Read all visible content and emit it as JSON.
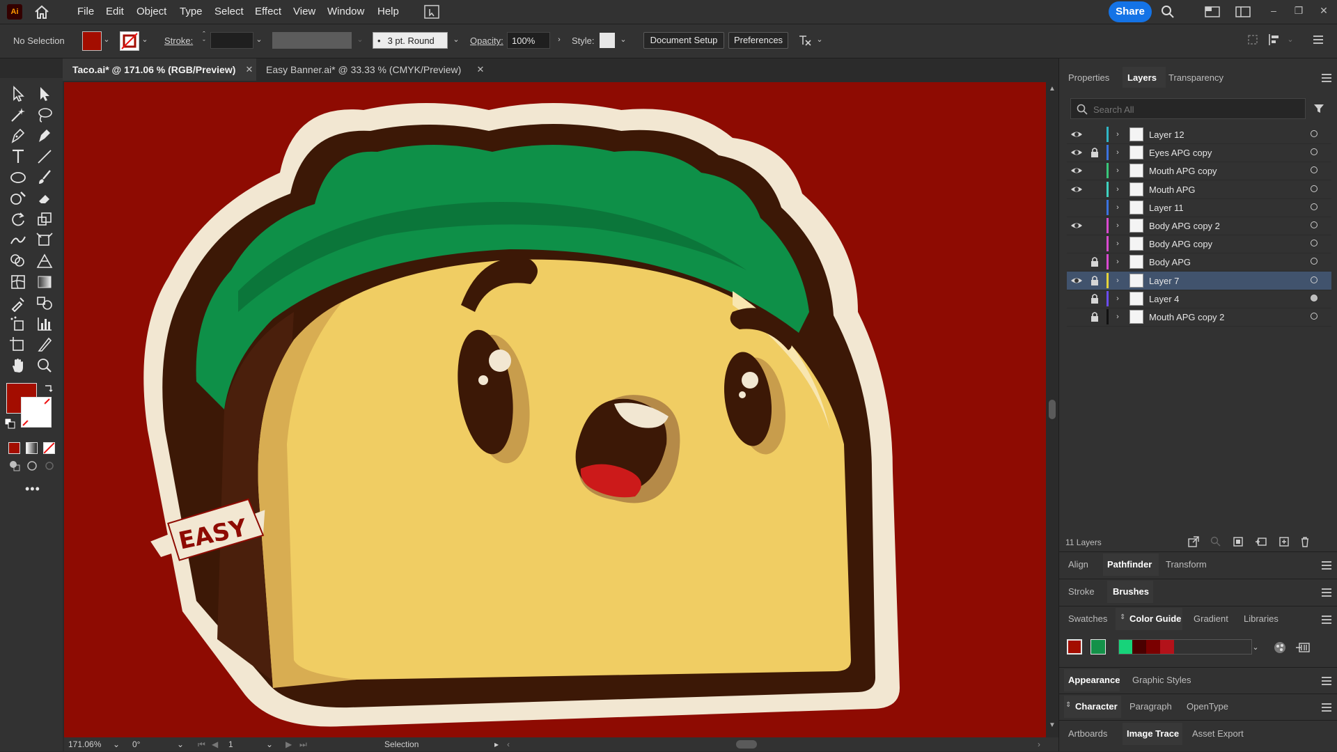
{
  "app": {
    "logo_text": "Ai"
  },
  "menu": [
    "File",
    "Edit",
    "Object",
    "Type",
    "Select",
    "Effect",
    "View",
    "Window",
    "Help"
  ],
  "share_label": "Share",
  "control_bar": {
    "selection_status": "No Selection",
    "stroke_label": "Stroke:",
    "brush_value": "3 pt. Round",
    "opacity_label": "Opacity:",
    "opacity_value": "100%",
    "style_label": "Style:",
    "document_setup": "Document Setup",
    "preferences": "Preferences",
    "fill_color": "#a30d00"
  },
  "tabs": [
    {
      "label": "Taco.ai* @ 171.06 % (RGB/Preview)",
      "active": true
    },
    {
      "label": "Easy Banner.ai* @ 33.33 % (CMYK/Preview)",
      "active": false
    }
  ],
  "canvas": {
    "background": "#8e0b02",
    "banner_text": "EASY"
  },
  "status": {
    "zoom": "171.06%",
    "rotation": "0°",
    "artboard": "1",
    "tool": "Selection"
  },
  "panels": {
    "top_tabs": [
      "Properties",
      "Layers",
      "Transparency"
    ],
    "search_placeholder": "Search All",
    "layers": [
      {
        "name": "Layer 12",
        "visible": true,
        "locked": false,
        "color": "#2fb6c6"
      },
      {
        "name": "Eyes APG copy",
        "visible": true,
        "locked": true,
        "color": "#3b73e0"
      },
      {
        "name": "Mouth APG copy",
        "visible": true,
        "locked": false,
        "color": "#38c77a"
      },
      {
        "name": "Mouth APG",
        "visible": true,
        "locked": false,
        "color": "#3fd3c0"
      },
      {
        "name": "Layer 11",
        "visible": false,
        "locked": false,
        "color": "#3b73e0"
      },
      {
        "name": "Body APG copy 2",
        "visible": true,
        "locked": false,
        "color": "#d94ad0"
      },
      {
        "name": "Body APG copy",
        "visible": false,
        "locked": false,
        "color": "#d94ad0"
      },
      {
        "name": "Body APG",
        "visible": false,
        "locked": true,
        "color": "#d94ad0"
      },
      {
        "name": "Layer 7",
        "visible": true,
        "locked": true,
        "color": "#e4d33a"
      },
      {
        "name": "Layer 4",
        "visible": false,
        "locked": true,
        "color": "#6a4cf0"
      },
      {
        "name": "Mouth APG copy 2",
        "visible": false,
        "locked": true,
        "color": "#111111"
      }
    ],
    "layer_count": "11 Layers",
    "group1_tabs": [
      "Align",
      "Pathfinder",
      "Transform"
    ],
    "group2_tabs": [
      "Stroke",
      "Brushes"
    ],
    "group3_tabs": [
      "Swatches",
      "Color Guide",
      "Gradient",
      "Libraries"
    ],
    "color_guide_swatches": [
      "#a30d00",
      "#149149",
      "#17d37a",
      "#4a0000",
      "#7a0000",
      "#b3121a"
    ],
    "group4_tabs": [
      "Appearance",
      "Graphic Styles"
    ],
    "group5_tabs": [
      "Character",
      "Paragraph",
      "OpenType"
    ],
    "group6_tabs": [
      "Artboards",
      "Image Trace",
      "Asset Export"
    ]
  }
}
